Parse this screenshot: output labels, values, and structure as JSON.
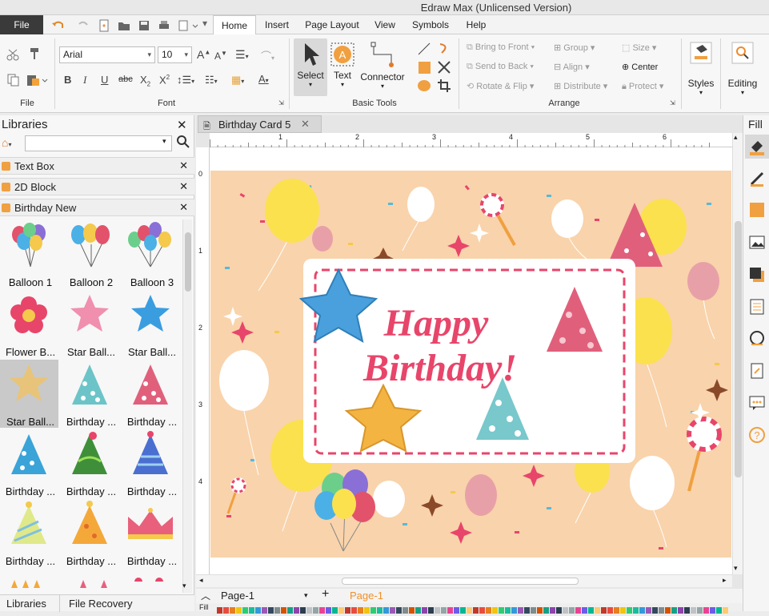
{
  "app": {
    "title": "Edraw Max (Unlicensed Version)"
  },
  "menu": {
    "file": "File",
    "items": [
      "Home",
      "Insert",
      "Page Layout",
      "View",
      "Symbols",
      "Help"
    ],
    "active": "Home"
  },
  "ribbon": {
    "font_name": "Arial",
    "font_size": "10",
    "groups": {
      "file": "File",
      "font": "Font",
      "basic_tools": "Basic Tools",
      "arrange": "Arrange"
    },
    "tools": {
      "select": "Select",
      "text": "Text",
      "connector": "Connector"
    },
    "arrange": {
      "bring_to_front": "Bring to Front",
      "send_to_back": "Send to Back",
      "rotate_flip": "Rotate & Flip",
      "group": "Group",
      "align": "Align",
      "distribute": "Distribute",
      "size": "Size",
      "center": "Center",
      "protect": "Protect"
    },
    "styles": "Styles",
    "editing": "Editing"
  },
  "libraries": {
    "title": "Libraries",
    "search_placeholder": "",
    "sections": [
      "Text Box",
      "2D Block",
      "Birthday New"
    ],
    "items": [
      "Balloon 1",
      "Balloon 2",
      "Balloon 3",
      "Flower B...",
      "Star Ball...",
      "Star Ball...",
      "Star Ball...",
      "Birthday ...",
      "Birthday ...",
      "Birthday ...",
      "Birthday ...",
      "Birthday ...",
      "Birthday ...",
      "Birthday ...",
      "Birthday ..."
    ],
    "bottom_tabs": [
      "Libraries",
      "File Recovery"
    ]
  },
  "document": {
    "tab": "Birthday Card 5",
    "ruler_top": [
      "1",
      "2",
      "3",
      "4",
      "5",
      "6"
    ],
    "ruler_left": [
      "0",
      "1",
      "2",
      "3",
      "4"
    ],
    "card_text_line1": "Happy",
    "card_text_line2": "Birthday!"
  },
  "pages": {
    "current": "Page-1",
    "tab": "Page-1"
  },
  "right_panel": {
    "title": "Fill",
    "bottom_label": "Fill"
  },
  "colors": {
    "accent": "#3a7bd5",
    "card_bg": "#f9d3ab",
    "card_text": "#e8456a",
    "page_tab": "#f0902a"
  }
}
